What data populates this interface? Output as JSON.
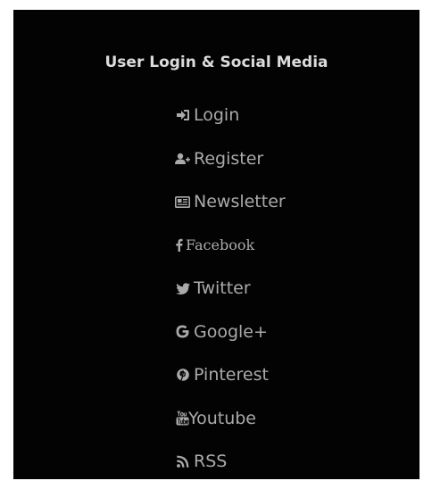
{
  "widget": {
    "title": "User Login & Social Media",
    "items": [
      {
        "label": "Login",
        "icon": "sign-in-icon"
      },
      {
        "label": "Register",
        "icon": "user-plus-icon"
      },
      {
        "label": "Newsletter",
        "icon": "newspaper-icon"
      },
      {
        "label": "Facebook",
        "icon": "facebook-icon"
      },
      {
        "label": "Twitter",
        "icon": "twitter-icon"
      },
      {
        "label": "Google+",
        "icon": "google-icon"
      },
      {
        "label": "Pinterest",
        "icon": "pinterest-icon"
      },
      {
        "label": "Youtube",
        "icon": "youtube-icon"
      },
      {
        "label": "RSS",
        "icon": "rss-icon"
      }
    ]
  },
  "colors": {
    "panel_background": "#030303",
    "title_text": "#dcdcdc",
    "item_text": "#aaaaaa"
  }
}
